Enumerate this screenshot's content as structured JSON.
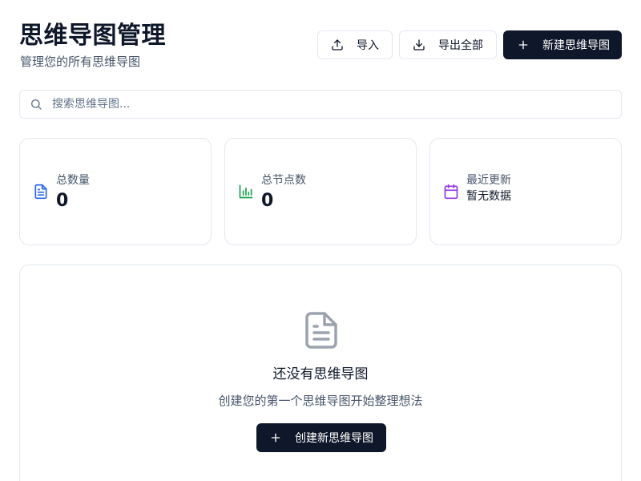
{
  "header": {
    "title": "思维导图管理",
    "subtitle": "管理您的所有思维导图"
  },
  "toolbar": {
    "import_label": "导入",
    "import_icon": "upload-icon",
    "export_label": "导出全部",
    "export_icon": "download-icon",
    "new_label": "新建思维导图",
    "new_icon": "plus-icon"
  },
  "search": {
    "placeholder": "搜索思维导图...",
    "value": "",
    "icon": "search-icon"
  },
  "stats": [
    {
      "label": "总数量",
      "value": "0",
      "icon": "file-text-icon",
      "color": "#2563eb"
    },
    {
      "label": "总节点数",
      "value": "0",
      "icon": "bar-chart-icon",
      "color": "#16a34a"
    },
    {
      "label": "最近更新",
      "value": "暂无数据",
      "icon": "calendar-icon",
      "color": "#9333ea"
    }
  ],
  "empty_state": {
    "icon": "file-text-icon",
    "title": "还没有思维导图",
    "description": "创建您的第一个思维导图开始整理想法",
    "button_label": "创建新思维导图",
    "button_icon": "plus-icon"
  },
  "colors": {
    "primary": "#0f172a",
    "border": "#e2e8f0",
    "muted_text": "#475569",
    "empty_icon": "#9ca3af"
  }
}
